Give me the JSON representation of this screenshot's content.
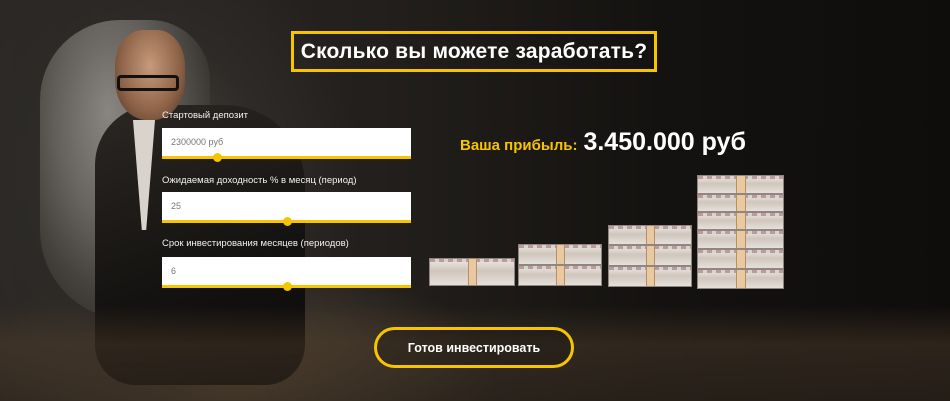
{
  "title": "Сколько вы можете заработать?",
  "fields": [
    {
      "label": "Стартовый депозит",
      "value": "2300000 руб",
      "slider_fraction": 0.22
    },
    {
      "label": "Ожидаемая доходность % в месяц (период)",
      "value": "25",
      "slider_fraction": 0.5
    },
    {
      "label": "Срок инвестирования месяцев (периодов)",
      "value": "6",
      "slider_fraction": 0.5
    }
  ],
  "profit": {
    "label": "Ваша прибыль:",
    "value": "3.450.000 руб"
  },
  "cta": {
    "label": "Готов инвестировать"
  },
  "colors": {
    "accent": "#f7c400",
    "text": "#ffffff"
  },
  "icons": [
    "money-stack-icon"
  ]
}
